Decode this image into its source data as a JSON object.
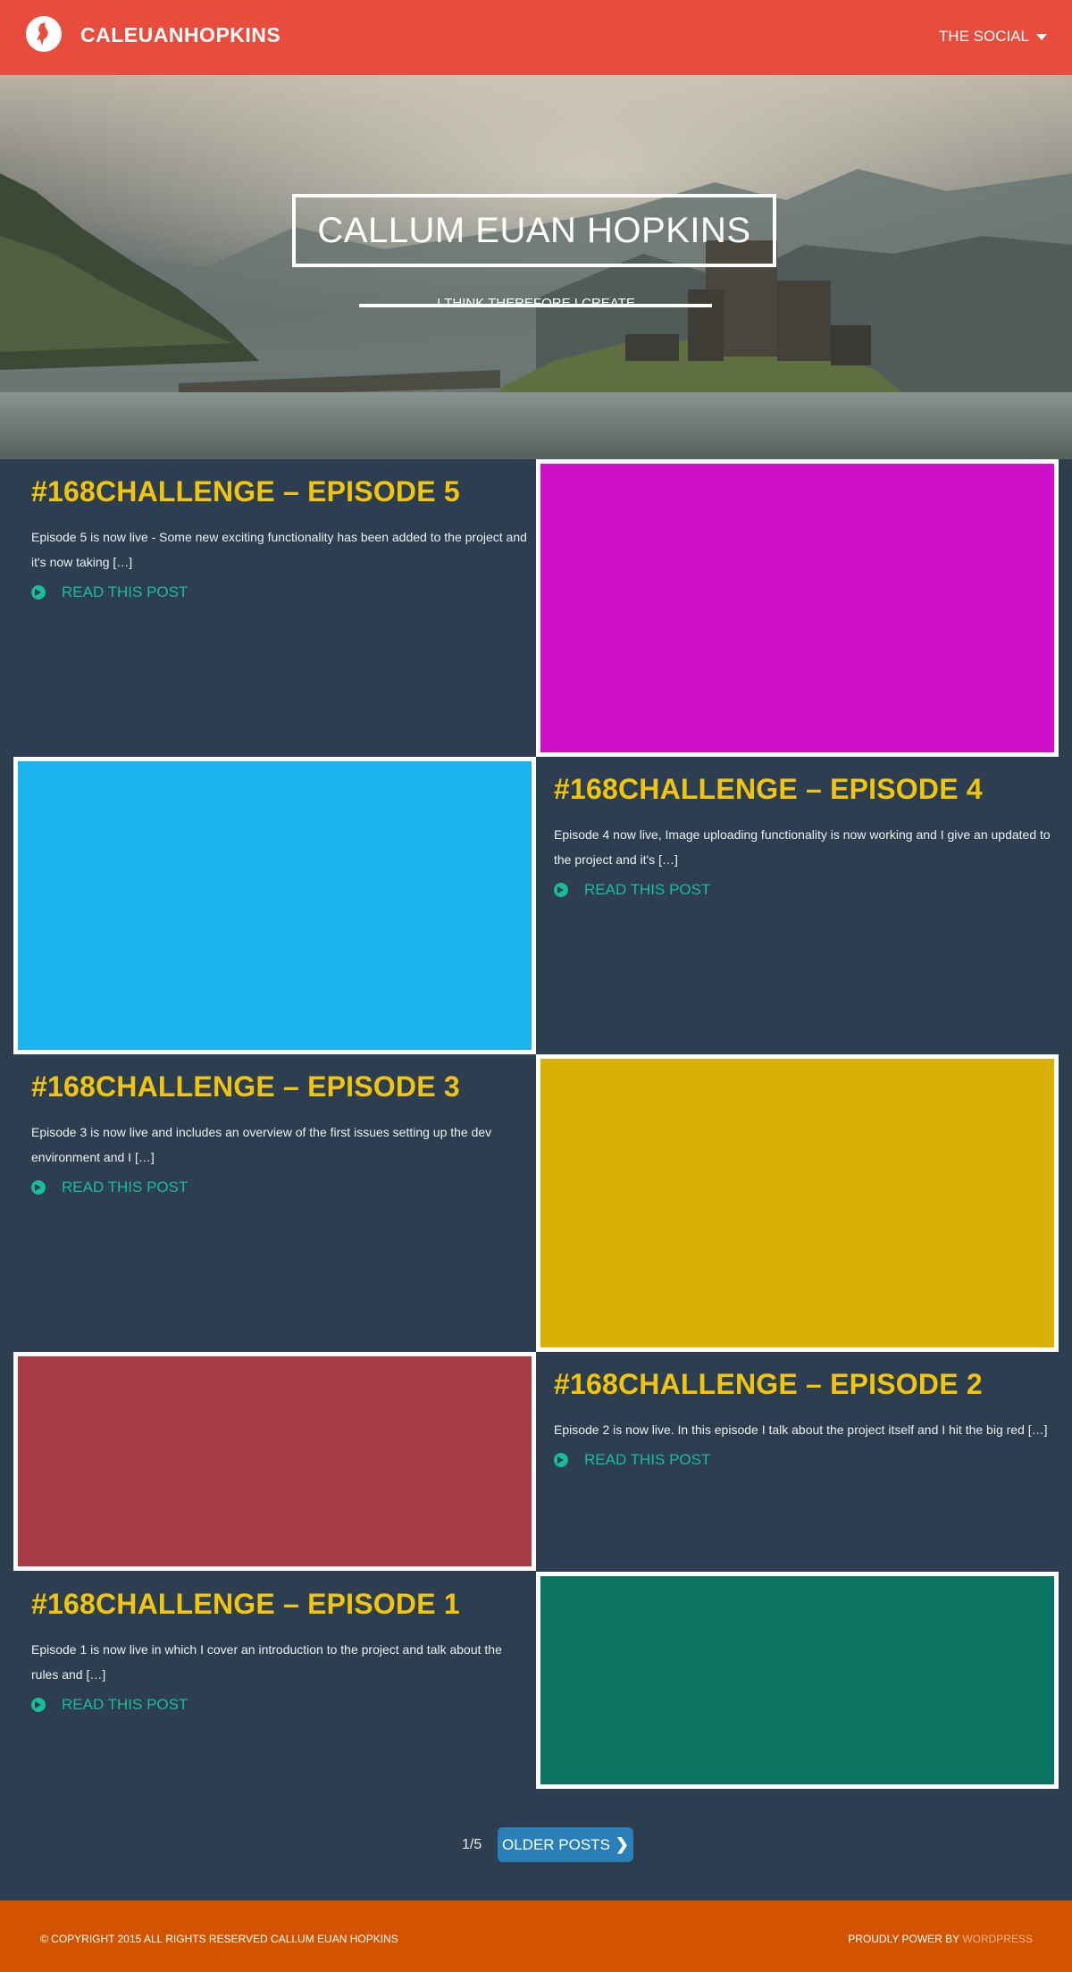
{
  "header": {
    "site_title": "CALEUANHOPKINS",
    "social_menu_label": "THE SOCIAL",
    "brand_color": "#e74c3c"
  },
  "hero": {
    "title": "CALLUM EUAN HOPKINS",
    "subtitle": "I THINK THEREFORE I CREATE"
  },
  "posts": [
    {
      "title": "#168CHALLENGE – EPISODE 5",
      "excerpt": "Episode 5 is now live - Some new exciting functionality has been added to the project and it's now taking […]",
      "link_label": "READ THIS POST",
      "image_color": "#d10ec9"
    },
    {
      "title": "#168CHALLENGE – EPISODE 4",
      "excerpt": "Episode 4 now live, Image uploading functionality is now working and I give an updated to the project and it's […]",
      "link_label": "READ THIS POST",
      "image_color": "#1ab3f0"
    },
    {
      "title": "#168CHALLENGE – EPISODE 3",
      "excerpt": "Episode 3 is now live and includes an overview of the first issues setting up the dev environment and I […]",
      "link_label": "READ THIS POST",
      "image_color": "#d9b003"
    },
    {
      "title": "#168CHALLENGE – EPISODE 2",
      "excerpt": "Episode 2 is now live. In this episode I talk about the project itself and I hit the big red […]",
      "link_label": "READ THIS POST",
      "image_color": "#a63b45"
    },
    {
      "title": "#168CHALLENGE – EPISODE 1",
      "excerpt": "Episode 1 is now live in which I cover an introduction to the project and talk about the rules and […]",
      "link_label": "READ THIS POST",
      "image_color": "#0b7362"
    }
  ],
  "pagination": {
    "page_count": "1/5",
    "older_label": "OLDER POSTS"
  },
  "footer": {
    "copyright": "© COPYRIGHT 2015 ALL RIGHTS RESERVED CALLUM EUAN HOPKINS",
    "powered_prefix": "PROUDLY POWER BY",
    "powered_link": "WORDPRESS",
    "footer_color": "#d35400"
  }
}
